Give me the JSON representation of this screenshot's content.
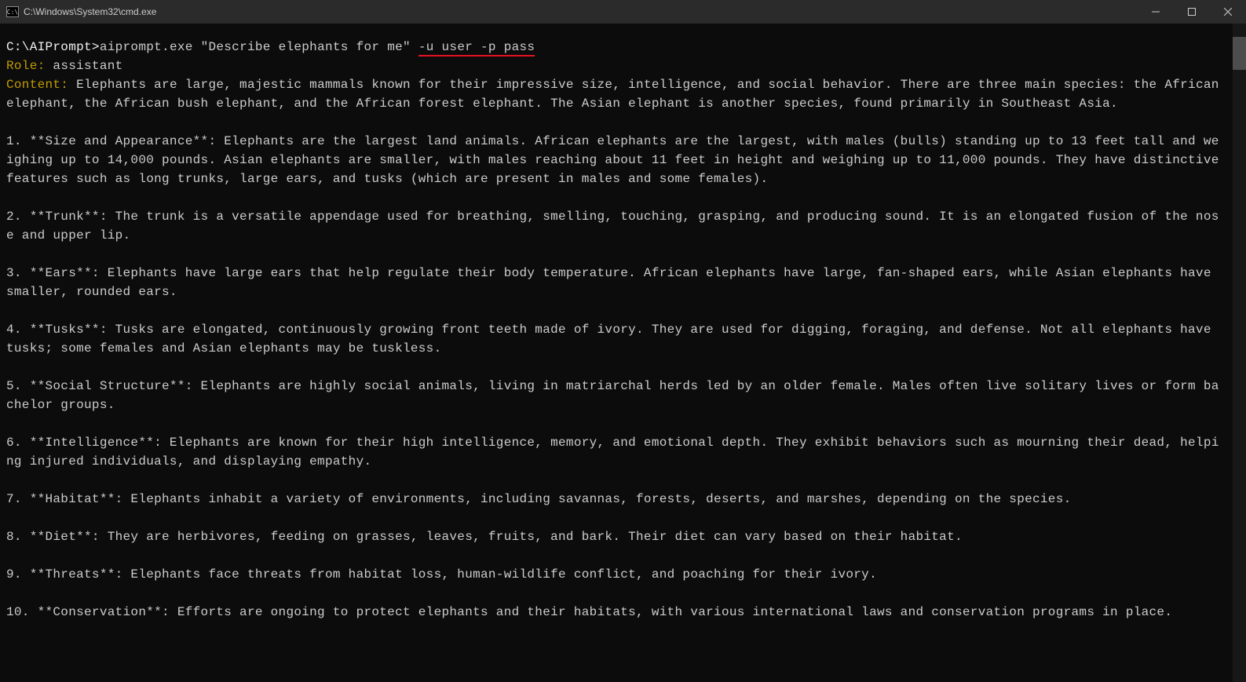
{
  "titlebar": {
    "icon_label": "C:\\",
    "title": "C:\\Windows\\System32\\cmd.exe"
  },
  "prompt": {
    "path": "C:\\AIPrompt>",
    "command_exe": "aiprompt.exe ",
    "command_arg_quoted": "\"Describe elephants for me\" ",
    "command_flags": "-u user -p pass"
  },
  "role": {
    "label": "Role: ",
    "value": "assistant"
  },
  "content": {
    "label": "Content: ",
    "intro": "Elephants are large, majestic mammals known for their impressive size, intelligence, and social behavior. There are three main species: the African elephant, the African bush elephant, and the African forest elephant. The Asian elephant is another species, found primarily in Southeast Asia."
  },
  "points": [
    "1. **Size and Appearance**: Elephants are the largest land animals. African elephants are the largest, with males (bulls) standing up to 13 feet tall and weighing up to 14,000 pounds. Asian elephants are smaller, with males reaching about 11 feet in height and weighing up to 11,000 pounds. They have distinctive features such as long trunks, large ears, and tusks (which are present in males and some females).",
    "2. **Trunk**: The trunk is a versatile appendage used for breathing, smelling, touching, grasping, and producing sound. It is an elongated fusion of the nose and upper lip.",
    "3. **Ears**: Elephants have large ears that help regulate their body temperature. African elephants have large, fan-shaped ears, while Asian elephants have smaller, rounded ears.",
    "4. **Tusks**: Tusks are elongated, continuously growing front teeth made of ivory. They are used for digging, foraging, and defense. Not all elephants have tusks; some females and Asian elephants may be tuskless.",
    "5. **Social Structure**: Elephants are highly social animals, living in matriarchal herds led by an older female. Males often live solitary lives or form bachelor groups.",
    "6. **Intelligence**: Elephants are known for their high intelligence, memory, and emotional depth. They exhibit behaviors such as mourning their dead, helping injured individuals, and displaying empathy.",
    "7. **Habitat**: Elephants inhabit a variety of environments, including savannas, forests, deserts, and marshes, depending on the species.",
    "8. **Diet**: They are herbivores, feeding on grasses, leaves, fruits, and bark. Their diet can vary based on their habitat.",
    "9. **Threats**: Elephants face threats from habitat loss, human-wildlife conflict, and poaching for their ivory.",
    "10. **Conservation**: Efforts are ongoing to protect elephants and their habitats, with various international laws and conservation programs in place."
  ]
}
